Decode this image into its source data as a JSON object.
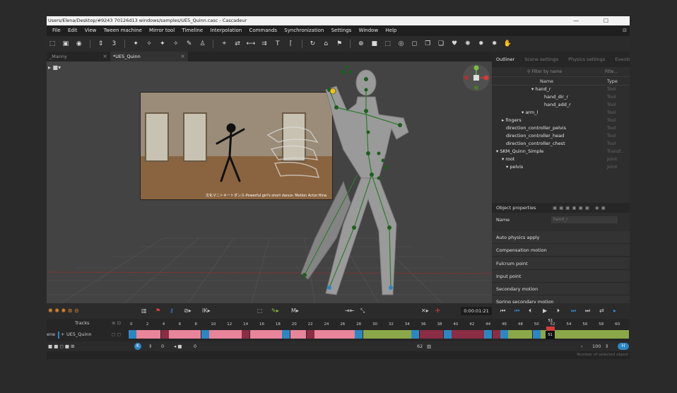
{
  "window": {
    "title": "Users/Elena/Desktop/#9243 70126d13 windows/samples/UE5_Quinn.casc - Cascadeur",
    "controls": "— ☐"
  },
  "menu": [
    "File",
    "Edit",
    "View",
    "Tween machine",
    "Mirror tool",
    "Timeline",
    "Interpolation",
    "Commands",
    "Synchronization",
    "Settings",
    "Window",
    "Help"
  ],
  "toolbar": {
    "frame_step": "3"
  },
  "tabs": [
    {
      "label": "_Manny"
    },
    {
      "label": "*UE5_Quinn"
    }
  ],
  "video": {
    "caption": "文化マニトキートダンス-Powerful girl's short dance- Motion Actor:Hina"
  },
  "outliner": {
    "tabs": [
      "Outliner",
      "Scene settings",
      "Physics settings",
      "Events"
    ],
    "filter_name_placeholder": "Filter by name",
    "filter_type_placeholder": "Filte...",
    "col_name": "Name",
    "col_type": "Type",
    "rows": [
      {
        "name": "▾ hand_r",
        "type": "Tool",
        "indent": 50
      },
      {
        "name": "hand_dir_r",
        "type": "Tool",
        "indent": 68
      },
      {
        "name": "hand_add_r",
        "type": "Tool",
        "indent": 68
      },
      {
        "name": "▾ arm_l",
        "type": "Tool",
        "indent": 36
      },
      {
        "name": "▸ fingers",
        "type": "Tool",
        "indent": 8
      },
      {
        "name": "direction_controller_pelvis",
        "type": "Tool",
        "indent": 14
      },
      {
        "name": "direction_controller_head",
        "type": "Tool",
        "indent": 14
      },
      {
        "name": "direction_controller_chest",
        "type": "Tool",
        "indent": 14
      },
      {
        "name": "▾ SKM_Quinn_Simple",
        "type": "Transf...",
        "indent": 0
      },
      {
        "name": "▾ root",
        "type": "Joint",
        "indent": 8
      },
      {
        "name": "▾ pelvis",
        "type": "Joint",
        "indent": 14
      }
    ]
  },
  "object_properties": {
    "title": "Object properties",
    "name_label": "Name",
    "name_value": "hand_r",
    "sections": [
      "Auto physics apply",
      "Compensation motion",
      "Fulcrum point",
      "Input point",
      "Secondary motion",
      "Spring secondary motion"
    ]
  },
  "playback": {
    "time": "0:00:01:21"
  },
  "timeline": {
    "tracks_label": "Tracks",
    "track_name": "UE5_Quinn",
    "scene_label": "ene",
    "ruler": [
      "0",
      "2",
      "4",
      "6",
      "8",
      "10",
      "12",
      "14",
      "16",
      "18",
      "20",
      "22",
      "24",
      "26",
      "28",
      "30",
      "32",
      "34",
      "36",
      "38",
      "40",
      "42",
      "44",
      "46",
      "48",
      "50",
      "52",
      "54",
      "56",
      "58",
      "60"
    ],
    "current_frame": "51",
    "frame_label": "51"
  },
  "bottom": {
    "start": "0",
    "end": "0",
    "keys_count": "62",
    "speed": "100"
  },
  "status": {
    "text": "Number of selected object"
  },
  "colors": {
    "pink": "#e8859a",
    "blue": "#2e86c1",
    "green": "#8aa84a",
    "maroon": "#8a2d45",
    "accent": "#f0c020"
  }
}
